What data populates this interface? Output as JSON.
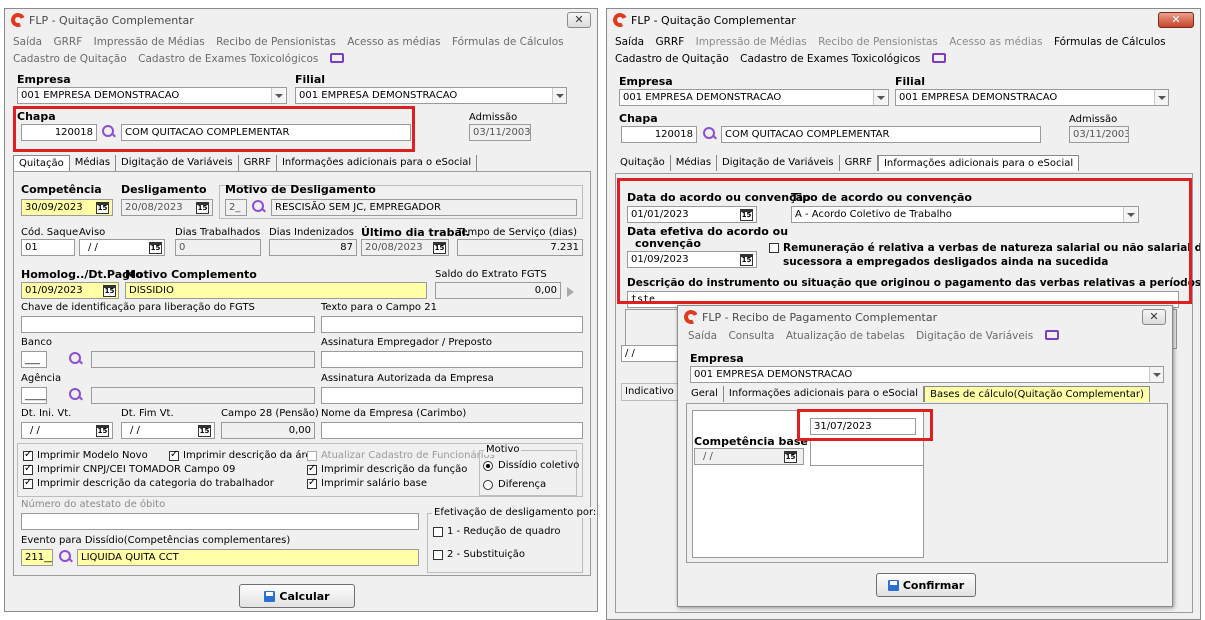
{
  "left_window": {
    "title": "FLP - Quitação Complementar",
    "close": "✕",
    "menu_row1": [
      "Saída",
      "GRRF",
      "Impressão de Médias",
      "Recibo de Pensionistas",
      "Acesso as médias",
      "Fórmulas de Cálculos"
    ],
    "menu_row2": [
      "Cadastro de Quitação",
      "Cadastro de Exames Toxicológicos"
    ],
    "empresa_label": "Empresa",
    "empresa_value": "001 EMPRESA DEMONSTRACAO",
    "filial_label": "Filial",
    "filial_value": "001 EMPRESA DEMONSTRACAO",
    "chapa_label": "Chapa",
    "chapa_value": "120018",
    "chapa_name": "COM QUITACAO COMPLEMENTAR",
    "admissao_label": "Admissão",
    "admissao_value": "03/11/2003",
    "tabs": [
      "Quitação",
      "Médias",
      "Digitação de Variáveis",
      "GRRF",
      "Informações adicionais para o eSocial"
    ],
    "competencia_label": "Competência",
    "competencia_value": "30/09/2023",
    "desligamento_label": "Desligamento",
    "desligamento_value": "20/08/2023",
    "motivo_label": "Motivo de Desligamento",
    "motivo_code": "2_",
    "motivo_value": "RESCISÃO SEM JC, EMPREGADOR",
    "cod_saque_label": "Cód. Saque",
    "cod_saque_value": "01",
    "aviso_label": "Aviso",
    "aviso_value": "/ /",
    "dias_trab_label": "Dias Trabalhados",
    "dias_trab_value": "0",
    "dias_indeniz_label": "Dias Indenizados",
    "dias_indeniz_value": "87",
    "ultimo_dia_label": "Último dia trabal.",
    "ultimo_dia_value": "20/08/2023",
    "tempo_servico_label": "Tempo de Serviço (dias)",
    "tempo_servico_value": "7.231",
    "homolog_label": "Homolog../Dt.Pagto",
    "homolog_value": "01/09/2023",
    "motivo_compl_label": "Motivo Complemento",
    "motivo_compl_value": "DISSIDIO",
    "saldo_fgts_label": "Saldo do Extrato FGTS",
    "saldo_fgts_value": "0,00",
    "chave_label": "Chave de identificação para liberação do FGTS",
    "texto21_label": "Texto para o Campo 21",
    "banco_label": "Banco",
    "banco_value": "___",
    "assin_emp_label": "Assinatura Empregador / Preposto",
    "agencia_label": "Agência",
    "agencia_value": "_____",
    "assin_aut_label": "Assinatura Autorizada da Empresa",
    "dt_ini_label": "Dt. Ini. Vt.",
    "dt_ini_value": "/ /",
    "dt_fim_label": "Dt. Fim Vt.",
    "dt_fim_value": "/ /",
    "campo28_label": "Campo 28 (Pensão)",
    "campo28_value": "0,00",
    "nome_empresa_label": "Nome da Empresa (Carimbo)",
    "checks": {
      "modelo_novo": "Imprimir Modelo Novo",
      "desc_area": "Imprimir descrição da área",
      "atualizar_cad": "Atualizar Cadastro de Funcionários",
      "cnpj": "Imprimir CNPJ/CEI TOMADOR Campo 09",
      "desc_funcao": "Imprimir descrição da função",
      "desc_categoria": "Imprimir descrição da categoria do trabalhador",
      "salario_base": "Imprimir salário base"
    },
    "motivo_group": "Motivo",
    "radio_dissidio": "Dissídio coletivo",
    "radio_diferenca": "Diferença",
    "obito_label": "Número do atestato de óbito",
    "efetivacao_label": "Efetivação de desligamento por:",
    "efetivacao_1": "1 - Redução de quadro",
    "efetivacao_2": "2 - Substituição",
    "evento_label": "Evento para Dissídio(Competências complementares)",
    "evento_code": "211__",
    "evento_value": "LIQUIDA QUITA CCT",
    "calcular": "Calcular"
  },
  "right_window": {
    "title": "FLP - Quitação Complementar",
    "close": "✕",
    "menu_row1": [
      "Saída",
      "GRRF",
      "Impressão de Médias",
      "Recibo de Pensionistas",
      "Acesso as médias",
      "Fórmulas de Cálculos"
    ],
    "menu_row2": [
      "Cadastro de Quitação",
      "Cadastro de Exames Toxicológicos"
    ],
    "empresa_label": "Empresa",
    "empresa_value": "001 EMPRESA DEMONSTRACAO",
    "filial_label": "Filial",
    "filial_value": "001 EMPRESA DEMONSTRACAO",
    "chapa_label": "Chapa",
    "chapa_value": "120018",
    "chapa_name": "COM QUITACAO COMPLEMENTAR",
    "admissao_label": "Admissão",
    "admissao_value": "03/11/2003",
    "tabs": [
      "Quitação",
      "Médias",
      "Digitação de Variáveis",
      "GRRF",
      "Informações adicionais para o eSocial"
    ],
    "data_acordo_label": "Data do acordo ou convenção",
    "data_acordo_value": "01/01/2023",
    "tipo_acordo_label": "Tipo de acordo ou convenção",
    "tipo_acordo_value": "A - Acordo Coletivo de Trabalho",
    "data_efetiva_label1": "Data efetiva do acordo ou",
    "data_efetiva_label2": "convenção",
    "data_efetiva_value": "01/09/2023",
    "remuneracao_label1": "Remuneração é relativa a verbas de natureza salarial ou não salarial devida:",
    "remuneracao_label2": "sucessora a empregados desligados ainda na sucedida",
    "descricao_label": "Descrição do instrumento ou situação que originou o pagamento das verbas relativas a períodos anteriores",
    "descricao_value": "tste",
    "partial_date": "/ /",
    "indicativo_label": "Indicativo se"
  },
  "dialog": {
    "title": "FLP - Recibo de Pagamento Complementar",
    "close": "✕",
    "menu": [
      "Saída",
      "Consulta",
      "Atualização de tabelas",
      "Digitação de Variáveis"
    ],
    "empresa_label": "Empresa",
    "empresa_value": "001 EMPRESA DEMONSTRACAO",
    "tabs": [
      "Geral",
      "Informações adicionais para o eSocial",
      "Bases de cálculo(Quitação Complementar)"
    ],
    "date_value": "31/07/2023",
    "competencia_base_label": "Competência base",
    "competencia_base_value": "/ /",
    "confirmar": "Confirmar"
  }
}
